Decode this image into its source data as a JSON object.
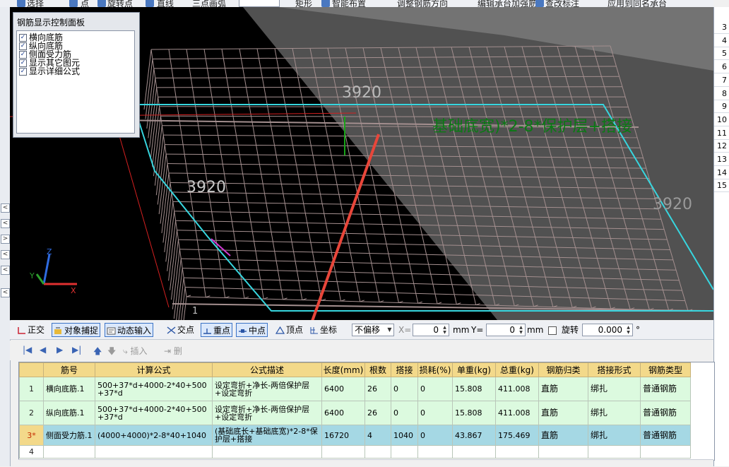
{
  "toolbar": {
    "items": [
      "选择",
      "点",
      "旋转点",
      "直线",
      "三点画弧",
      "矩形",
      "智能布置",
      "调整钢筋方向",
      "编辑承台加强筋",
      "查改标注",
      "应用到同名承台"
    ]
  },
  "left_strip": {
    "buttons": [
      "<",
      "<",
      ">",
      "<",
      "<",
      "<"
    ]
  },
  "control_panel": {
    "title": "钢筋显示控制面板",
    "items": [
      {
        "label": "横向底筋",
        "checked": true
      },
      {
        "label": "纵向底筋",
        "checked": true
      },
      {
        "label": "侧面受力筋",
        "checked": true
      },
      {
        "label": "显示其它图元",
        "checked": true
      },
      {
        "label": "显示详细公式",
        "checked": true
      }
    ]
  },
  "viewport": {
    "dim_labels": [
      "3920",
      "3920",
      "3920"
    ],
    "formula_label": "基础底宽)*2-8*保护层+搭接",
    "small_label": "1",
    "axes": {
      "z": "Z",
      "y": "Y",
      "x": "X"
    },
    "colors": {
      "rebar": "#a48f8f",
      "outline": "#37d6df",
      "formula": "#0a7a14",
      "pointer_arrow": "#e8463a"
    }
  },
  "right_panel": {
    "row_numbers": [
      "3",
      "4",
      "5",
      "6",
      "7",
      "8",
      "9",
      "10",
      "11",
      "12",
      "13",
      "14",
      "15"
    ]
  },
  "snapbar": {
    "ortho": "正交",
    "object_snap": "对象捕捉",
    "dynamic_input": "动态输入",
    "intersection": "交点",
    "midpoint_snap": "重点",
    "center_snap": "中点",
    "vertex": "顶点",
    "coordinate": "坐标",
    "offset_mode": "不偏移",
    "x_label": "X=",
    "x_value": "0",
    "x_unit": "mm",
    "y_label": "Y=",
    "y_value": "0",
    "y_unit": "mm",
    "rotate_label": "旋转",
    "rotate_value": "0.000",
    "degree": "°"
  },
  "navbar": {
    "insert": "插入",
    "delete": "删"
  },
  "table": {
    "headers": [
      "",
      "筋号",
      "计算公式",
      "公式描述",
      "长度(mm)",
      "根数",
      "搭接",
      "损耗(%)",
      "单重(kg)",
      "总重(kg)",
      "钢筋归类",
      "搭接形式",
      "钢筋类型"
    ],
    "rows": [
      {
        "no": "1",
        "name": "横向底筋.1",
        "formula": "500+37*d+4000-2*40+500+37*d",
        "desc": "设定弯折+净长-两倍保护层+设定弯折",
        "length": "6400",
        "count": "26",
        "lap": "0",
        "loss": "0",
        "unit_w": "15.808",
        "total_w": "411.008",
        "category": "直筋",
        "lap_type": "绑扎",
        "bar_type": "普通钢筋"
      },
      {
        "no": "2",
        "name": "纵向底筋.1",
        "formula": "500+37*d+4000-2*40+500+37*d",
        "desc": "设定弯折+净长-两倍保护层+设定弯折",
        "length": "6400",
        "count": "26",
        "lap": "0",
        "loss": "0",
        "unit_w": "15.808",
        "total_w": "411.008",
        "category": "直筋",
        "lap_type": "绑扎",
        "bar_type": "普通钢筋"
      },
      {
        "no": "3*",
        "name": "侧面受力筋.1",
        "formula": "(4000+4000)*2-8*40+1040",
        "desc": "(基础底长+基础底宽)*2-8*保护层+搭接",
        "length": "16720",
        "count": "4",
        "lap": "1040",
        "loss": "0",
        "unit_w": "43.867",
        "total_w": "175.469",
        "category": "直筋",
        "lap_type": "绑扎",
        "bar_type": "普通钢筋"
      },
      {
        "no": "4",
        "name": "",
        "formula": "",
        "desc": "",
        "length": "",
        "count": "",
        "lap": "",
        "loss": "",
        "unit_w": "",
        "total_w": "",
        "category": "",
        "lap_type": "",
        "bar_type": ""
      }
    ]
  }
}
